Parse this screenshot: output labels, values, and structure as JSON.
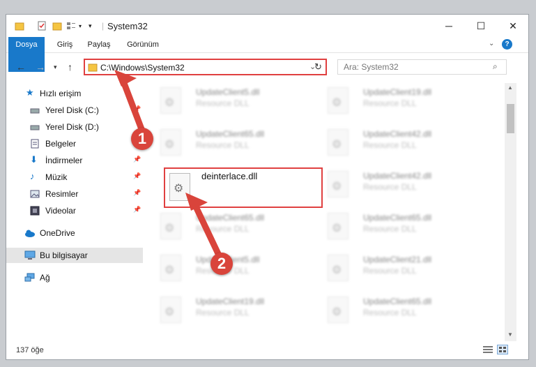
{
  "window": {
    "title": "System32"
  },
  "ribbon": {
    "tabs": [
      "Dosya",
      "Giriş",
      "Paylaş",
      "Görünüm"
    ]
  },
  "address": {
    "path": "C:\\Windows\\System32"
  },
  "search": {
    "placeholder": "Ara: System32"
  },
  "sidebar": {
    "items": [
      {
        "label": "Hızlı erişim",
        "icon": "star-icon"
      },
      {
        "label": "Yerel Disk (C:)",
        "icon": "drive-icon"
      },
      {
        "label": "Yerel Disk (D:)",
        "icon": "drive-icon"
      },
      {
        "label": "Belgeler",
        "icon": "documents-icon"
      },
      {
        "label": "İndirmeler",
        "icon": "download-icon"
      },
      {
        "label": "Müzik",
        "icon": "music-icon"
      },
      {
        "label": "Resimler",
        "icon": "pictures-icon"
      },
      {
        "label": "Videolar",
        "icon": "videos-icon"
      },
      {
        "label": "OneDrive",
        "icon": "cloud-icon"
      },
      {
        "label": "Bu bilgisayar",
        "icon": "computer-icon"
      },
      {
        "label": "Ağ",
        "icon": "network-icon"
      }
    ]
  },
  "files": {
    "highlighted": {
      "name": "deinterlace.dll"
    },
    "blurred": [
      {
        "name": "UpdateClient5.dll",
        "type": "Resource DLL"
      },
      {
        "name": "UpdateClient19.dll",
        "type": "Resource DLL"
      },
      {
        "name": "UpdateClient65.dll",
        "type": "Resource DLL"
      },
      {
        "name": "UpdateClient42.dll",
        "type": "Resource DLL"
      },
      {
        "name": "UpdateClient42.dll",
        "type": "Resource DLL"
      },
      {
        "name": "UpdateClient65.dll",
        "type": "Resource DLL"
      },
      {
        "name": "UpdateClient65.dll",
        "type": "Resource DLL"
      },
      {
        "name": "UpdateClient5.dll",
        "type": "Resource DLL"
      },
      {
        "name": "UpdateClient21.dll",
        "type": "Resource DLL"
      },
      {
        "name": "UpdateClient19.dll",
        "type": "Resource DLL"
      },
      {
        "name": "UpdateClient65.dll",
        "type": "Resource DLL"
      }
    ]
  },
  "status": {
    "count": "137 öğe"
  },
  "annotations": {
    "step1": "1",
    "step2": "2"
  },
  "colors": {
    "accent": "#1979ca",
    "highlight": "#e04040",
    "badge": "#d9443b"
  }
}
